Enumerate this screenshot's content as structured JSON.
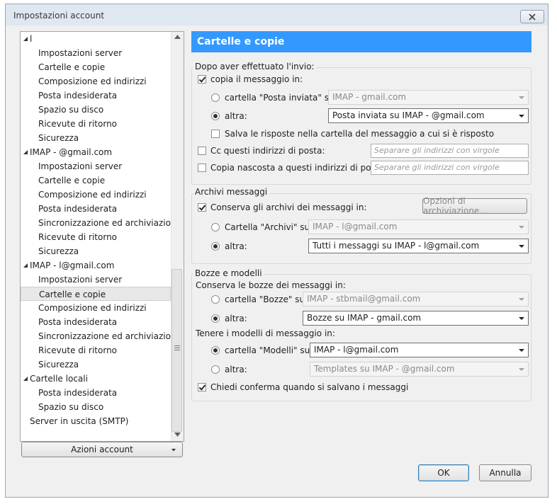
{
  "window": {
    "title": "Impostazioni account"
  },
  "tree": [
    {
      "label": "l",
      "top": true
    },
    {
      "label": "Impostazioni server"
    },
    {
      "label": "Cartelle e copie"
    },
    {
      "label": "Composizione ed indirizzi"
    },
    {
      "label": "Posta indesiderata"
    },
    {
      "label": "Spazio su disco"
    },
    {
      "label": "Ricevute di ritorno"
    },
    {
      "label": "Sicurezza"
    },
    {
      "label": "IMAP -                          @gmail.com",
      "top": true
    },
    {
      "label": "Impostazioni server"
    },
    {
      "label": "Cartelle e copie"
    },
    {
      "label": "Composizione ed indirizzi"
    },
    {
      "label": "Posta indesiderata"
    },
    {
      "label": "Sincronizzazione ed archiviazione"
    },
    {
      "label": "Ricevute di ritorno"
    },
    {
      "label": "Sicurezza"
    },
    {
      "label": "IMAP -            l@gmail.com",
      "top": true
    },
    {
      "label": "Impostazioni server"
    },
    {
      "label": "Cartelle e copie",
      "selected": true
    },
    {
      "label": "Composizione ed indirizzi"
    },
    {
      "label": "Posta indesiderata"
    },
    {
      "label": "Sincronizzazione ed archiviazione"
    },
    {
      "label": "Ricevute di ritorno"
    },
    {
      "label": "Sicurezza"
    },
    {
      "label": "Cartelle locali",
      "top": true
    },
    {
      "label": "Posta indesiderata"
    },
    {
      "label": "Spazio su disco"
    },
    {
      "label": "Server in uscita (SMTP)",
      "top": true,
      "notwisty": true
    }
  ],
  "account_actions": {
    "label": "Azioni account"
  },
  "panel": {
    "header": "Cartelle e copie",
    "sent": {
      "legend": "Dopo aver effettuato l'invio:",
      "copy_label": "copia il messaggio in:",
      "sent_folder_label": "cartella \"Posta inviata\" su:",
      "sent_folder_value": "IMAP -               gmail.com",
      "other_label": "altra:",
      "other_value": "Posta inviata su IMAP -             @gmail.com",
      "reply_label": "Salva le risposte nella cartella del messaggio a cui si è risposto",
      "cc_label": "Cc questi indirizzi di posta:",
      "cc_placeholder": "Separare gli indirizzi con virgole",
      "bcc_label": "Copia nascosta a questi indirizzi di posta:",
      "bcc_placeholder": "Separare gli indirizzi con virgole"
    },
    "archive": {
      "legend": "Archivi messaggi",
      "keep_label": "Conserva gli archivi dei messaggi in:",
      "options_button": "Opzioni di archiviazione...",
      "folder_label": "Cartella \"Archivi\" su:",
      "folder_value": "IMAP -               l@gmail.com",
      "other_label": "altra:",
      "other_value": "Tutti i messaggi su IMAP -            l@gmail.com"
    },
    "drafts": {
      "legend": "Bozze e modelli",
      "drafts_heading": "Conserva le bozze dei messaggi in:",
      "drafts_folder_label": "cartella \"Bozze\" su:",
      "drafts_folder_value": "IMAP - stbmail@gmail.com",
      "drafts_other_label": "altra:",
      "drafts_other_value": "Bozze su IMAP -             gmail.com",
      "templates_heading": "Tenere i modelli di messaggio in:",
      "templates_folder_label": "cartella \"Modelli\" su:",
      "templates_folder_value": "IMAP -               l@gmail.com",
      "templates_other_label": "altra:",
      "templates_other_value": "Templates su IMAP -               @gmail.com",
      "confirm_label": "Chiedi conferma quando si salvano i messaggi"
    }
  },
  "buttons": {
    "ok": "OK",
    "cancel": "Annulla"
  },
  "colors": {
    "header_bg": "#3399ff",
    "selection": "#e8e8e8"
  }
}
